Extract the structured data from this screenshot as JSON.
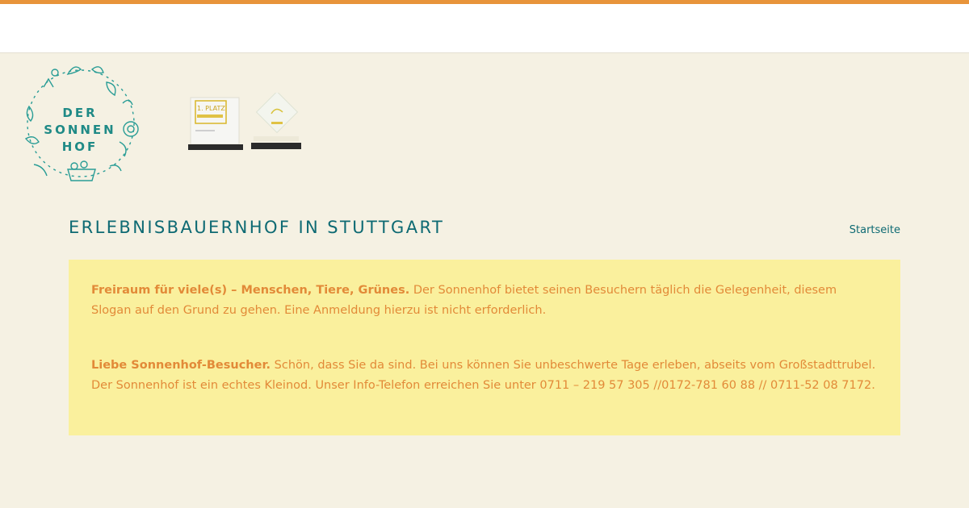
{
  "colors": {
    "accent_top_bar": "#e8943a",
    "background": "#f5f1e3",
    "teal": "#0e6a73",
    "box": "#faf09d",
    "box_text": "#e28a38"
  },
  "logo": {
    "line1": "DER",
    "line2": "SONNEN",
    "line3": "HOF",
    "icon": "floral-wreath-logo"
  },
  "awards": {
    "award1_text": "1. PLATZ",
    "icon1": "award-trophy-icon",
    "icon2": "award-diamond-icon"
  },
  "page": {
    "title": "ERLEBNISBAUERNHOF IN STUTTGART",
    "breadcrumb_home": "Startseite"
  },
  "info": {
    "p1_bold": "Freiraum für viele(s) – Menschen, Tiere, Grünes.",
    "p1_text": " Der Sonnenhof bietet seinen Besuchern täglich die Gelegenheit, diesem Slogan auf den Grund zu gehen. Eine Anmeldung hierzu ist nicht erforderlich.",
    "p2_bold": "Liebe Sonnenhof-Besucher.",
    "p2_text": " Schön, dass Sie da sind. Bei uns können Sie unbeschwerte Tage erleben, abseits vom Großstadttrubel. Der Sonnenhof ist ein echtes Kleinod. Unser Info-Telefon erreichen Sie unter 0711 – 219 57 305     //0172-781 60 88 // 0711-52 08 7172."
  }
}
